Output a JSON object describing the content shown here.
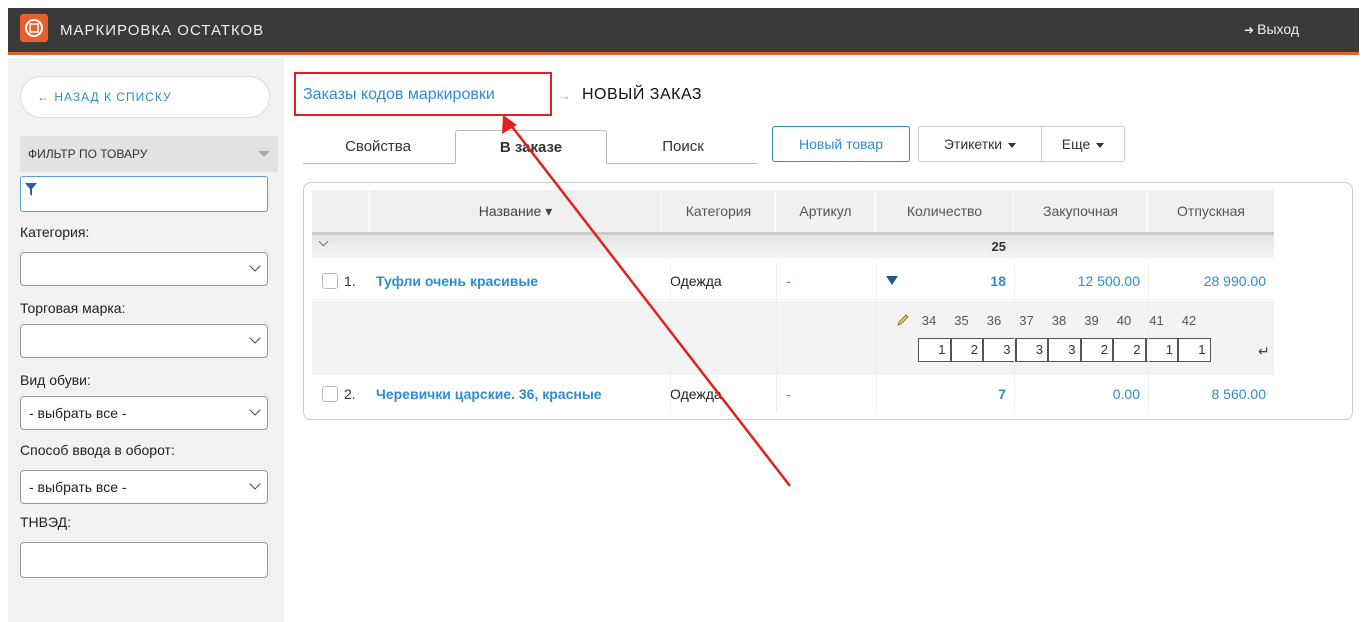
{
  "topbar": {
    "app_title": "МАРКИРОВКА ОСТАТКОВ",
    "logout_label": "Выход",
    "logout_icon": "sign-out-icon",
    "accent": "#e8612c"
  },
  "sidebar": {
    "back_label": "← НАЗАД К СПИСКУ",
    "filter_title": "ФИЛЬТР ПО ТОВАРУ",
    "filter_value": "",
    "fields": {
      "category_label": "Категория:",
      "category_value": "",
      "brand_label": "Торговая марка:",
      "brand_value": "",
      "shoe_type_label": "Вид обуви:",
      "shoe_type_value": "- выбрать все -",
      "circulation_label": "Способ ввода в оборот:",
      "circulation_value": "- выбрать все -",
      "tnved_label": "ТНВЭД:",
      "tnved_value": ""
    }
  },
  "breadcrumb": {
    "link": "Заказы кодов маркировки",
    "separator": "→",
    "current": "НОВЫЙ ЗАКАЗ"
  },
  "tabs": [
    {
      "label": "Свойства"
    },
    {
      "label": "В заказе"
    },
    {
      "label": "Поиск"
    }
  ],
  "toolbar": {
    "new_item": "Новый товар",
    "labels": "Этикетки",
    "more": "Еще"
  },
  "table": {
    "headers": {
      "name": "Название ▾",
      "category": "Категория",
      "article": "Артикул",
      "quantity": "Количество",
      "purchase": "Закупочная",
      "retail": "Отпускная"
    },
    "group_total": "25",
    "rows": [
      {
        "index": "1.",
        "name": "Туфли очень красивые",
        "category": "Одежда",
        "article": "-",
        "quantity": "18",
        "purchase": "12 500.00",
        "retail": "28 990.00"
      },
      {
        "index": "2.",
        "name": "Черевички царские. 36, красные",
        "category": "Одежда",
        "article": "-",
        "quantity": "7",
        "purchase": "0.00",
        "retail": "8 560.00"
      }
    ],
    "sizes": [
      "34",
      "35",
      "36",
      "37",
      "38",
      "39",
      "40",
      "41",
      "42"
    ],
    "size_quantities": [
      "1",
      "2",
      "3",
      "3",
      "3",
      "2",
      "2",
      "1",
      "1"
    ],
    "enter_glyph": "↵"
  }
}
